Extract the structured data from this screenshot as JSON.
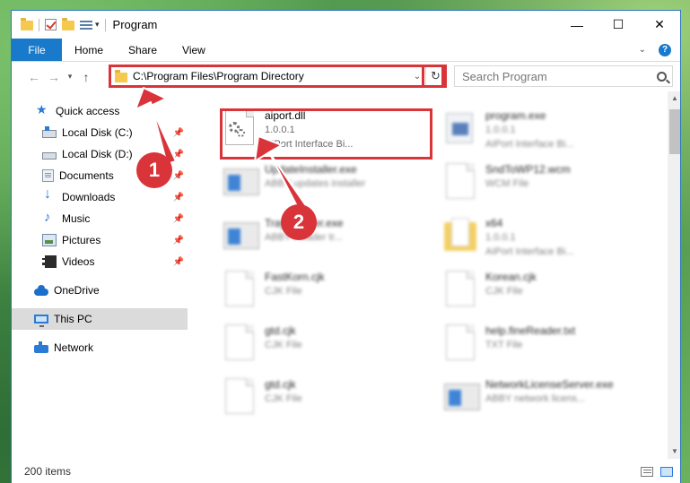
{
  "window": {
    "title": "Program",
    "minimize_glyph": "—",
    "maximize_glyph": "☐",
    "close_glyph": "✕"
  },
  "ribbon": {
    "tabs": [
      "File",
      "Home",
      "Share",
      "View"
    ]
  },
  "nav": {
    "back_glyph": "←",
    "forward_glyph": "→",
    "recent_glyph": "▾",
    "up_glyph": "↑",
    "address": "C:\\Program Files\\Program Directory",
    "address_dropdown_glyph": "⌄",
    "refresh_glyph": "↻",
    "search_placeholder": "Search Program"
  },
  "sidebar": {
    "items": [
      {
        "label": "Quick access",
        "icon": "star-icon"
      },
      {
        "label": "Local Disk (C:)",
        "icon": "disk-icon"
      },
      {
        "label": "Local Disk (D:)",
        "icon": "disk-icon"
      },
      {
        "label": "Documents",
        "icon": "documents-icon"
      },
      {
        "label": "Downloads",
        "icon": "downloads-icon"
      },
      {
        "label": "Music",
        "icon": "music-icon"
      },
      {
        "label": "Pictures",
        "icon": "pictures-icon"
      },
      {
        "label": "Videos",
        "icon": "videos-icon"
      },
      {
        "label": "OneDrive",
        "icon": "cloud-icon"
      },
      {
        "label": "This PC",
        "icon": "computer-icon"
      },
      {
        "label": "Network",
        "icon": "network-icon"
      }
    ]
  },
  "files": [
    {
      "name": "aiport.dll",
      "line2": "1.0.0.1",
      "line3": "AIPort Interface Bi..."
    },
    {
      "name": "program.exe",
      "line2": "1.0.0.1",
      "line3": "AIPort Interface Bi..."
    },
    {
      "name": "UpdateInstaller.exe",
      "line2": "ABBY updates installer",
      "line3": ""
    },
    {
      "name": "SndToWP12.wcm",
      "line2": "WCM File",
      "line3": ""
    },
    {
      "name": "TrayInstaller.exe",
      "line2": "ABBY Reader tr...",
      "line3": ""
    },
    {
      "name": "x64",
      "line2": "1.0.0.1",
      "line3": "AIPort Interface Bi..."
    },
    {
      "name": "FastKorn.cjk",
      "line2": "CJK File",
      "line3": ""
    },
    {
      "name": "Korean.cjk",
      "line2": "CJK File",
      "line3": ""
    },
    {
      "name": "gtd.cjk",
      "line2": "CJK File",
      "line3": ""
    },
    {
      "name": "help.fineReader.txt",
      "line2": "TXT File",
      "line3": ""
    },
    {
      "name": "gtd.cjk",
      "line2": "CJK File",
      "line3": ""
    },
    {
      "name": "NetworkLicenseServer.exe",
      "line2": "ABBY network licens...",
      "line3": ""
    }
  ],
  "status": {
    "item_count": "200 items"
  },
  "annotations": {
    "step1": "1",
    "step2": "2",
    "color": "#d9343a"
  },
  "colors": {
    "accent": "#1979ca",
    "highlight": "#d9343a"
  }
}
